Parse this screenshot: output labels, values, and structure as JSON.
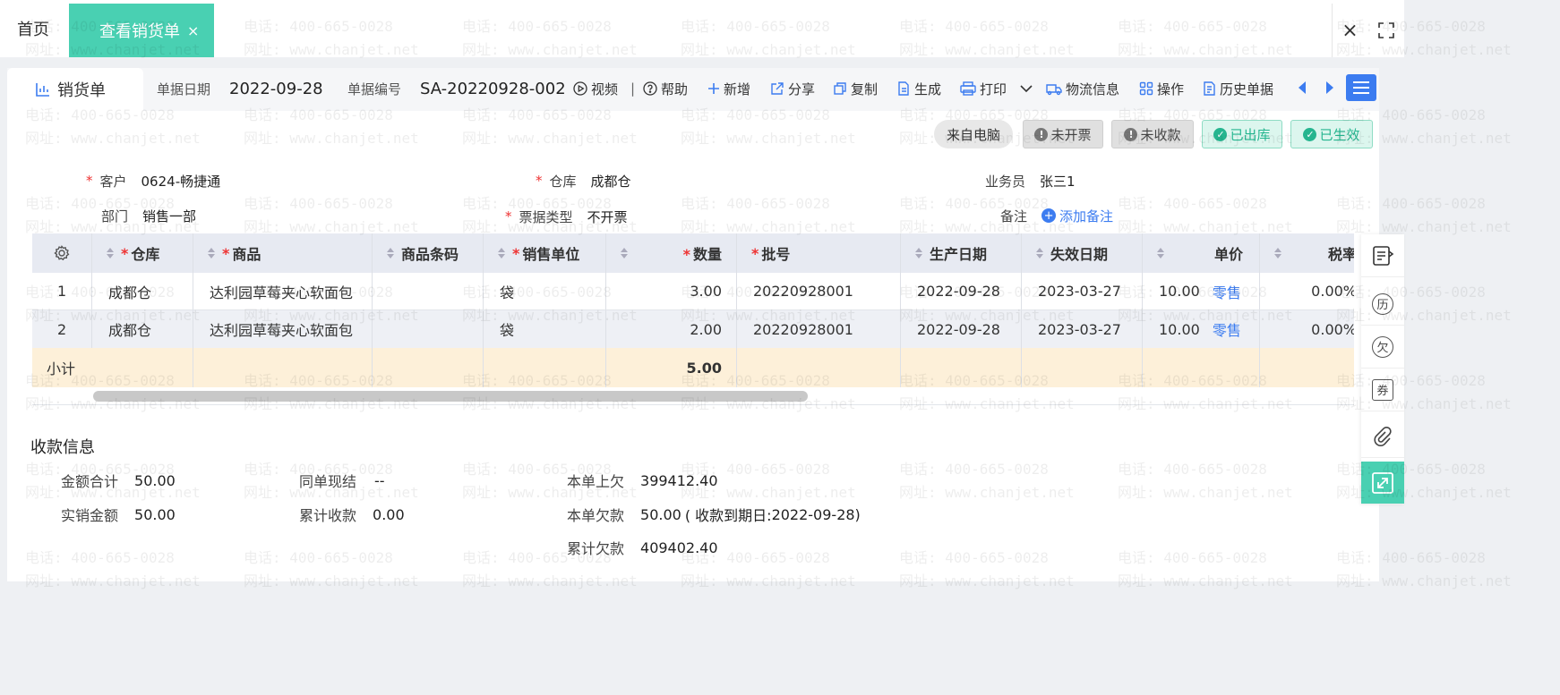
{
  "tabs": {
    "home": "首页",
    "active": "查看销货单",
    "active_close": "×",
    "window_close": "×"
  },
  "doc": {
    "tab_label": "销货单",
    "date_label": "单据日期",
    "date_value": "2022-09-28",
    "no_label": "单据编号",
    "no_value": "SA-20220928-002"
  },
  "toolbar": {
    "video": "视频",
    "separator": "|",
    "help": "帮助",
    "add": "新增",
    "share": "分享",
    "copy": "复制",
    "generate": "生成",
    "print": "打印",
    "logistics": "物流信息",
    "operate": "操作",
    "history": "历史单据"
  },
  "badges": {
    "source": "来自电脑",
    "uninvoiced": "未开票",
    "uncollected": "未收款",
    "shipped": "已出库",
    "effective": "已生效"
  },
  "form": {
    "required_mark": "*",
    "customer_label": "客户",
    "customer_value": "0624-畅捷通",
    "warehouse_label": "仓库",
    "warehouse_value": "成都仓",
    "salesman_label": "业务员",
    "salesman_value": "张三1",
    "dept_label": "部门",
    "dept_value": "销售一部",
    "invoice_type_label": "票据类型",
    "invoice_type_value": "不开票",
    "note_label": "备注",
    "add_note": "添加备注"
  },
  "table": {
    "headers": {
      "warehouse": "仓库",
      "product": "商品",
      "barcode": "商品条码",
      "unit": "销售单位",
      "qty": "数量",
      "batch": "批号",
      "mfg_date": "生产日期",
      "exp_date": "失效日期",
      "price": "单价",
      "tax_rate": "税率"
    },
    "rows": [
      {
        "idx": "1",
        "warehouse": "成都仓",
        "product": "达利园草莓夹心软面包",
        "barcode": "",
        "unit": "袋",
        "qty": "3.00",
        "batch": "20220928001",
        "mfg_date": "2022-09-28",
        "exp_date": "2023-03-27",
        "price": "10.00",
        "price_type": "零售",
        "tax_rate": "0.00%"
      },
      {
        "idx": "2",
        "warehouse": "成都仓",
        "product": "达利园草莓夹心软面包",
        "barcode": "",
        "unit": "袋",
        "qty": "2.00",
        "batch": "20220928001",
        "mfg_date": "2022-09-28",
        "exp_date": "2023-03-27",
        "price": "10.00",
        "price_type": "零售",
        "tax_rate": "0.00%"
      }
    ],
    "subtotal_label": "小计",
    "subtotal_qty": "5.00"
  },
  "payment": {
    "title": "收款信息",
    "total_label": "金额合计",
    "total_value": "50.00",
    "actual_label": "实销金额",
    "actual_value": "50.00",
    "cash_label": "同单现结",
    "cash_value": "--",
    "collected_label": "累计收款",
    "collected_value": "0.00",
    "prev_debt_label": "本单上欠",
    "prev_debt_value": "399412.40",
    "debt_label": "本单欠款",
    "debt_value": "50.00",
    "due_open": "( 收款到期日: ",
    "due_date": "2022-09-28",
    "due_close": " )",
    "cum_debt_label": "累计欠款",
    "cum_debt_value": "409402.40"
  },
  "side_panel": {
    "history_glyph": "历",
    "debt_glyph": "欠",
    "coupon_glyph": "券"
  },
  "watermark": {
    "phone": "电话: 400-665-0028",
    "site": "网址: www.chanjet.net"
  },
  "colors": {
    "accent_teal": "#49d0b2",
    "link_blue": "#3c7cf0",
    "required_red": "#e33333",
    "debt_red": "#c62828",
    "subtotal_bg": "#fdf0d9"
  }
}
